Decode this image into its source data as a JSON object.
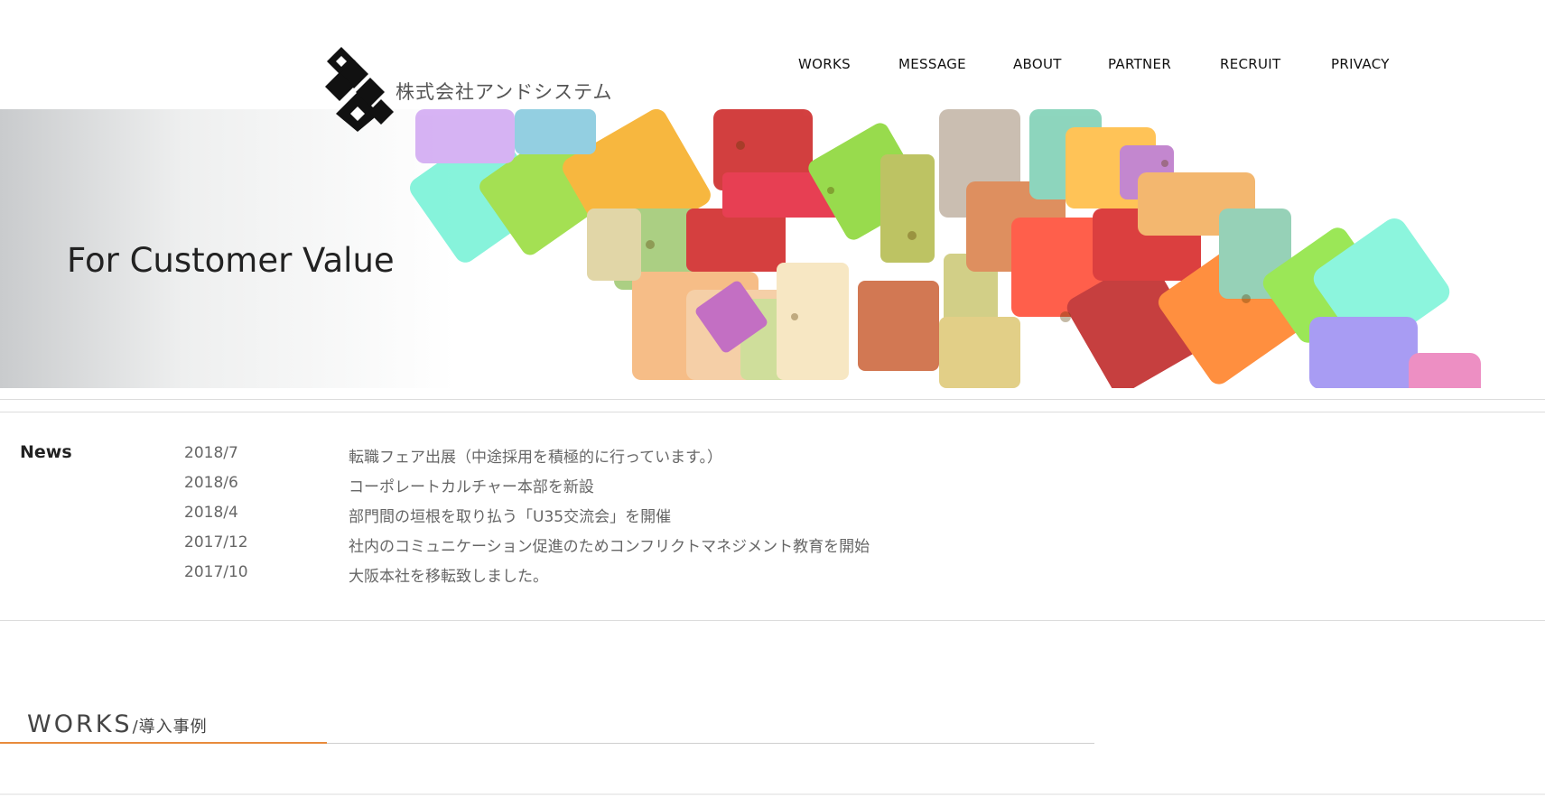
{
  "header": {
    "company_name": "株式会社アンドシステム",
    "logo_icon": "ampersand-logo-icon"
  },
  "nav": {
    "items": [
      {
        "label": "WORKS"
      },
      {
        "label": "MESSAGE"
      },
      {
        "label": "ABOUT"
      },
      {
        "label": "PARTNER"
      },
      {
        "label": "RECRUIT"
      },
      {
        "label": "PRIVACY"
      }
    ]
  },
  "hero": {
    "tagline": "For Customer Value"
  },
  "news": {
    "title": "News",
    "items": [
      {
        "date": "2018/7",
        "text": "転職フェア出展（中途採用を積極的に行っています。）"
      },
      {
        "date": "2018/6",
        "text": "コーポレートカルチャー本部を新設"
      },
      {
        "date": "2018/4",
        "text": "部門間の垣根を取り払う「U35交流会」を開催"
      },
      {
        "date": "2017/12",
        "text": "社内のコミュニケーション促進のためコンフリクトマネジメント教育を開始"
      },
      {
        "date": "2017/10",
        "text": "大阪本社を移転致しました。"
      }
    ]
  },
  "works": {
    "heading_en": "WORKS",
    "heading_jp": "/導入事例"
  },
  "colors": {
    "accent_orange": "#e88b3c",
    "text_gray": "#666666",
    "rule_gray": "#dcdcdc"
  }
}
